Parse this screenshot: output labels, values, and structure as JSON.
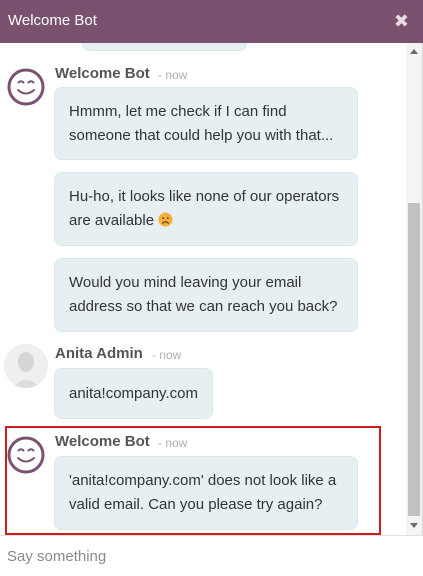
{
  "header": {
    "title": "Welcome Bot",
    "close_glyph": "✖"
  },
  "messages": [
    {
      "author": "Welcome Bot",
      "time": "- now",
      "bubbles": [
        "Hmmm, let me check if I can find someone that could help you with that...",
        "Hu-ho, it looks like none of our operators are available",
        "Would you mind leaving your email address so that we can reach you back?"
      ]
    },
    {
      "author": "Anita Admin",
      "time": "- now",
      "bubbles": [
        "anita!company.com"
      ]
    },
    {
      "author": "Welcome Bot",
      "time": "- now",
      "bubbles": [
        "'anita!company.com' does not look like a valid email. Can you please try again?"
      ]
    }
  ],
  "composer": {
    "placeholder": "Say something"
  },
  "icons": {
    "bot_avatar": "smiley-face-icon",
    "user_avatar": "person-silhouette-icon",
    "sad_emoji": "sad-face-emoji",
    "close": "close-icon"
  },
  "colors": {
    "header_bg": "#7a5270",
    "bubble_bg": "#e6f0f3",
    "highlight": "#d01c1c",
    "bot_avatar": "#7a5270"
  }
}
